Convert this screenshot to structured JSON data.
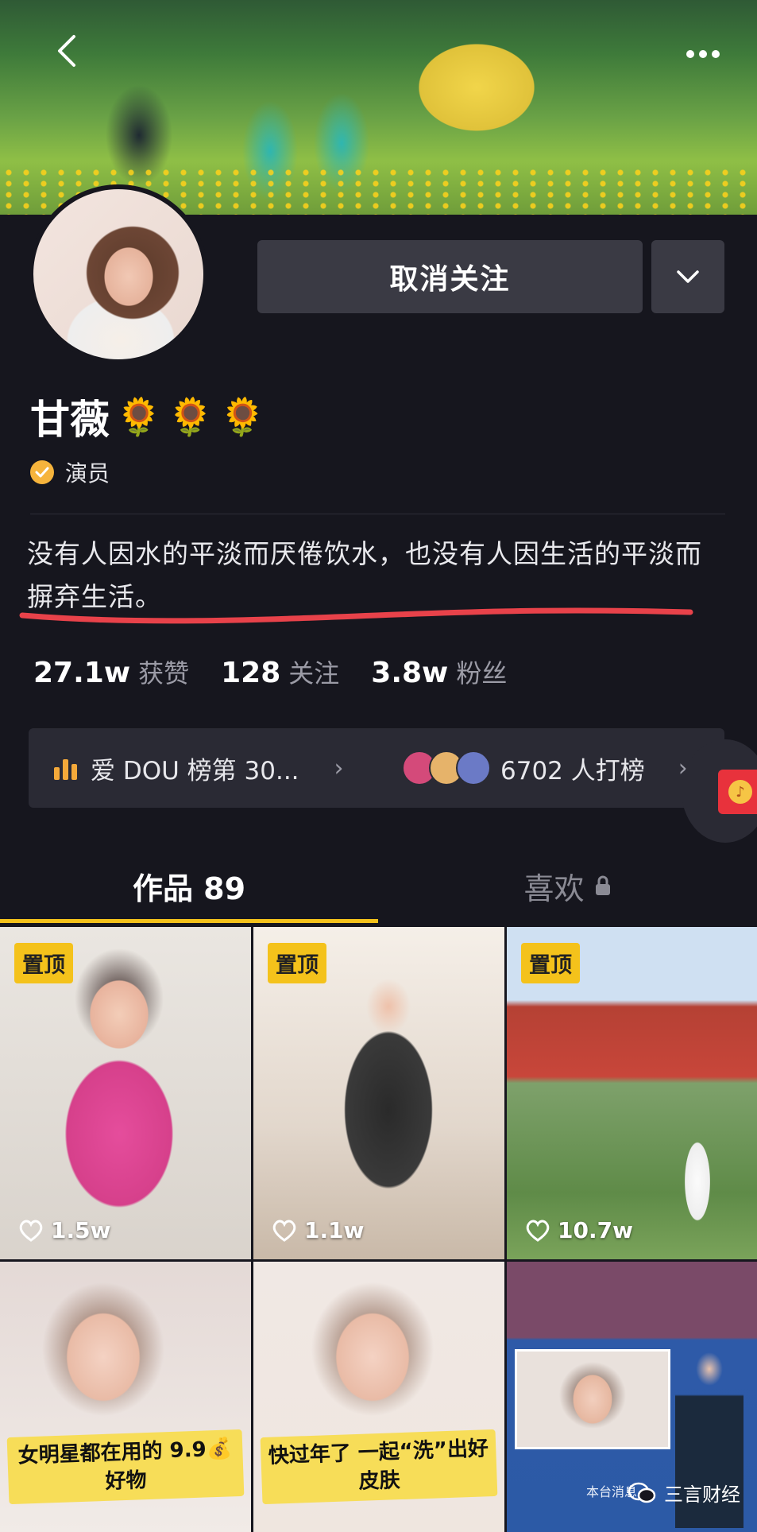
{
  "profile": {
    "name": "甘薇",
    "emoji": [
      "🌻",
      "🌻",
      "🌻"
    ],
    "verification": "演员",
    "bio": "没有人因水的平淡而厌倦饮水，也没有人因生活的平淡而摒弃生活。",
    "unfollow_label": "取消关注"
  },
  "stats": [
    {
      "value": "27.1w",
      "label": "获赞"
    },
    {
      "value": "128",
      "label": "关注"
    },
    {
      "value": "3.8w",
      "label": "粉丝"
    }
  ],
  "rank": {
    "left_label": "爱 DOU 榜第 30...",
    "right_label": "6702 人打榜"
  },
  "tabs": {
    "works": "作品 89",
    "likes": "喜欢"
  },
  "videos": [
    {
      "badge": "置顶",
      "likes": "1.5w"
    },
    {
      "badge": "置顶",
      "likes": "1.1w"
    },
    {
      "badge": "置顶",
      "likes": "10.7w"
    },
    {
      "caption": "女明星都在用的 9.9💰好物"
    },
    {
      "caption": "快过年了 一起“洗”出好皮肤"
    },
    {
      "caption": "本台消息"
    }
  ],
  "watermark": "三言财经",
  "colors": {
    "accent": "#f4c21b",
    "background": "#16161e",
    "underline_annotation": "#e8424a"
  }
}
